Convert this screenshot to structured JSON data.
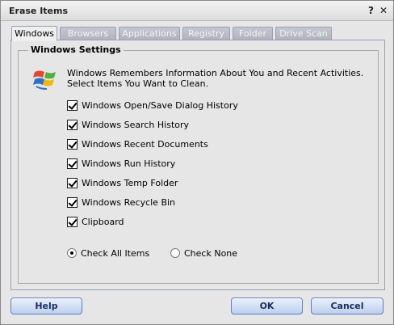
{
  "window": {
    "title": "Erase Items",
    "help_glyph": "?",
    "close_glyph": "✕"
  },
  "tabs": [
    {
      "label": "Windows",
      "active": true
    },
    {
      "label": "Browsers",
      "active": false
    },
    {
      "label": "Applications",
      "active": false
    },
    {
      "label": "Registry",
      "active": false
    },
    {
      "label": "Folder",
      "active": false
    },
    {
      "label": "Drive Scan",
      "active": false
    }
  ],
  "group": {
    "title": "Windows Settings",
    "icon": "windows-logo-icon",
    "description_line1": "Windows Remembers Information About You and Recent Activities.",
    "description_line2": "Select Items You Want to Clean."
  },
  "items": [
    {
      "label": "Windows Open/Save Dialog History",
      "checked": true
    },
    {
      "label": "Windows Search History",
      "checked": true
    },
    {
      "label": "Windows Recent Documents",
      "checked": true
    },
    {
      "label": "Windows Run History",
      "checked": true
    },
    {
      "label": "Windows Temp Folder",
      "checked": true
    },
    {
      "label": "Windows Recycle Bin",
      "checked": true
    },
    {
      "label": "Clipboard",
      "checked": true
    }
  ],
  "selection": {
    "check_all_label": "Check All Items",
    "check_none_label": "Check None",
    "selected": "check_all"
  },
  "buttons": {
    "help": "Help",
    "ok": "OK",
    "cancel": "Cancel"
  },
  "colors": {
    "button_border": "#5d7fbf",
    "inactive_tab": "#aeb2bd",
    "window_bg": "#e6e6e6"
  }
}
